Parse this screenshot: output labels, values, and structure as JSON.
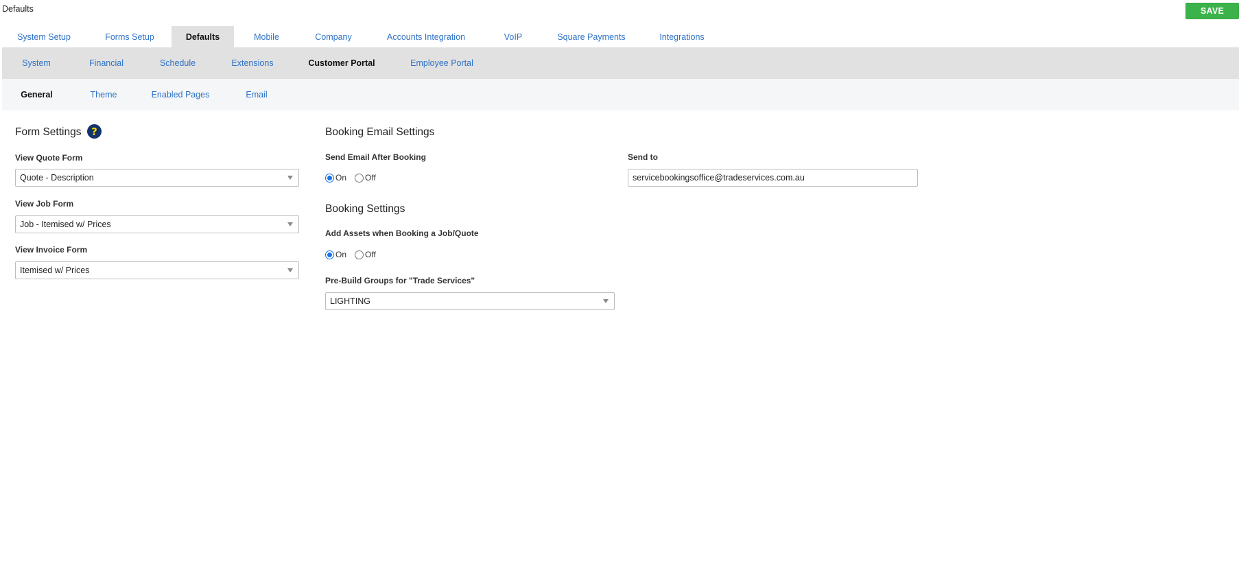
{
  "header": {
    "title": "Defaults",
    "save_label": "SAVE"
  },
  "main_tabs": [
    {
      "label": "System Setup"
    },
    {
      "label": "Forms Setup"
    },
    {
      "label": "Defaults"
    },
    {
      "label": "Mobile"
    },
    {
      "label": "Company"
    },
    {
      "label": "Accounts Integration"
    },
    {
      "label": "VoIP"
    },
    {
      "label": "Square Payments"
    },
    {
      "label": "Integrations"
    }
  ],
  "main_tabs_active": "Defaults",
  "sub_tabs": [
    {
      "label": "System"
    },
    {
      "label": "Financial"
    },
    {
      "label": "Schedule"
    },
    {
      "label": "Extensions"
    },
    {
      "label": "Customer Portal"
    },
    {
      "label": "Employee Portal"
    }
  ],
  "sub_tabs_active": "Customer Portal",
  "third_tabs": [
    {
      "label": "General"
    },
    {
      "label": "Theme"
    },
    {
      "label": "Enabled Pages"
    },
    {
      "label": "Email"
    }
  ],
  "third_tabs_active": "General",
  "form_settings": {
    "heading": "Form Settings",
    "help_glyph": "?",
    "quote": {
      "label": "View Quote Form",
      "value": "Quote - Description"
    },
    "job": {
      "label": "View Job Form",
      "value": "Job - Itemised w/ Prices"
    },
    "invoice": {
      "label": "View Invoice Form",
      "value": "Itemised w/ Prices"
    }
  },
  "booking_email": {
    "heading": "Booking Email Settings",
    "send_email": {
      "label": "Send Email After Booking",
      "on_label": "On",
      "off_label": "Off",
      "selected": "On"
    },
    "send_to": {
      "label": "Send to",
      "value": "servicebookingsoffice@tradeservices.com.au"
    }
  },
  "booking_settings": {
    "heading": "Booking Settings",
    "add_assets": {
      "label": "Add Assets when Booking a Job/Quote",
      "on_label": "On",
      "off_label": "Off",
      "selected": "On"
    },
    "pre_build": {
      "label": "Pre-Build Groups for \"Trade Services\"",
      "value": "LIGHTING"
    }
  },
  "colors": {
    "accent_link": "#2d72c7",
    "save_green": "#3cb34a",
    "tab_active_bg": "#e1e1e1",
    "help_icon_bg": "#12336b",
    "help_icon_fg": "#ffd500"
  }
}
